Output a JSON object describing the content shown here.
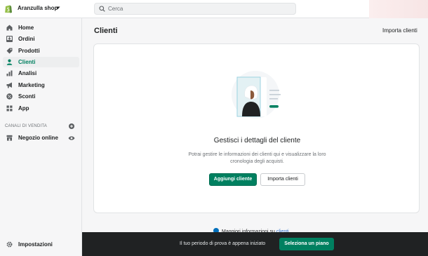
{
  "topbar": {
    "shop_name": "Aranzulla shop",
    "search_placeholder": "Cerca"
  },
  "sidebar": {
    "items": [
      {
        "label": "Home",
        "icon": "home-icon"
      },
      {
        "label": "Ordini",
        "icon": "orders-icon"
      },
      {
        "label": "Prodotti",
        "icon": "tag-icon"
      },
      {
        "label": "Clienti",
        "icon": "person-icon",
        "active": true
      },
      {
        "label": "Analisi",
        "icon": "bar-chart-icon"
      },
      {
        "label": "Marketing",
        "icon": "megaphone-icon"
      },
      {
        "label": "Sconti",
        "icon": "discount-icon"
      },
      {
        "label": "App",
        "icon": "apps-icon"
      }
    ],
    "sales_channels_title": "CANALI DI VENDITA",
    "online_store": "Negozio online",
    "settings": "Impostazioni"
  },
  "main": {
    "title": "Clienti",
    "import_link": "Importa clienti",
    "empty_state": {
      "heading": "Gestisci i dettagli del cliente",
      "description": "Potrai gestire le informazioni dei clienti qui e visualizzare la loro cronologia degli acquisti.",
      "primary_button": "Aggiungi cliente",
      "secondary_button": "Importa clienti"
    },
    "learn_more_prefix": "Maggiori informazioni su",
    "learn_more_link": "clienti"
  },
  "trial_bar": {
    "text": "Il tuo periodo di prova è appena iniziato",
    "button": "Seleziona un piano"
  },
  "colors": {
    "accent": "#008060",
    "trial_bar": "#202223",
    "link": "#2c6ecb"
  }
}
